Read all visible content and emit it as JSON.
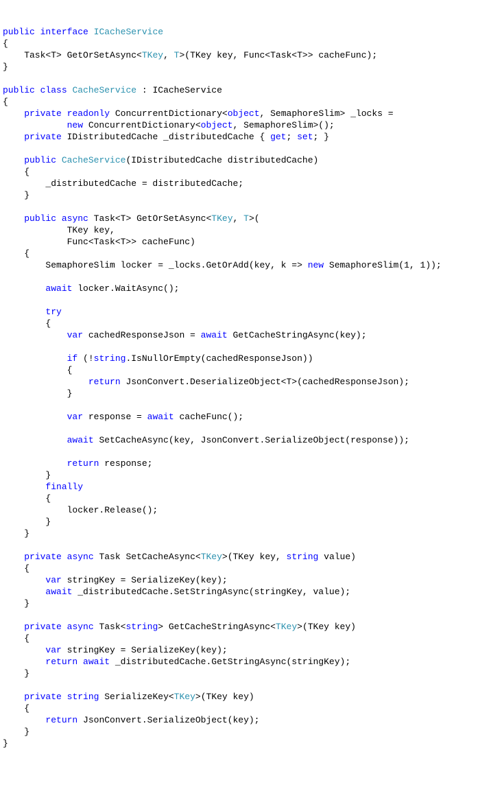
{
  "k": {
    "public": "public",
    "interface": "interface",
    "class": "class",
    "private": "private",
    "readonly": "readonly",
    "new": "new",
    "get": "get",
    "set": "set",
    "async": "async",
    "await": "await",
    "try": "try",
    "finally": "finally",
    "var": "var",
    "if": "if",
    "return": "return",
    "string_kw": "string",
    "object_kw": "object"
  },
  "t": {
    "ICacheService": "ICacheService",
    "CacheService": "CacheService",
    "TKey": "TKey",
    "T": "T"
  },
  "code": {
    "l3": "    Task<T> GetOrSetAsync<",
    "l3b": ">(TKey key, Func<Task<T>> cacheFunc);",
    "l6b": " : ICacheService",
    "l8a": " ConcurrentDictionary<",
    "l8b": ", SemaphoreSlim> _locks =",
    "l9a": " ConcurrentDictionary<",
    "l9b": ", SemaphoreSlim>();",
    "l10a": " IDistributedCache _distributedCache { ",
    "l10b": "; ",
    "l10c": "; }",
    "l12a": "(IDistributedCache distributedCache)",
    "l14": "        _distributedCache = distributedCache;",
    "l17a": " Task<T> GetOrSetAsync<",
    "l17b": ">(",
    "l18": "            TKey key,",
    "l19": "            Func<Task<T>> cacheFunc)",
    "l21a": "        SemaphoreSlim locker = _locks.GetOrAdd(key, k => ",
    "l21b": " SemaphoreSlim(1, 1));",
    "l23a": " locker.WaitAsync();",
    "l27a": " cachedResponseJson = ",
    "l27b": " GetCacheStringAsync(key);",
    "l29a": " (!",
    "l29b": ".IsNullOrEmpty(cachedResponseJson))",
    "l31a": " JsonConvert.DeserializeObject<T>(cachedResponseJson);",
    "l34a": " response = ",
    "l34b": " cacheFunc();",
    "l36a": " SetCacheAsync(key, JsonConvert.SerializeObject(response));",
    "l38a": " response;",
    "l42": "            locker.Release();",
    "l46a": " Task SetCacheAsync<",
    "l46b": ">(TKey key, ",
    "l46c": " value)",
    "l48a": " stringKey = SerializeKey(key);",
    "l49a": " _distributedCache.SetStringAsync(stringKey, value);",
    "l52a": " Task<",
    "l52b": "> GetCacheStringAsync<",
    "l52c": ">(TKey key)",
    "l54a": " stringKey = SerializeKey(key);",
    "l55a": " _distributedCache.GetStringAsync(stringKey);",
    "l58a": " SerializeKey<",
    "l58b": ">(TKey key)",
    "l60a": " JsonConvert.SerializeObject(key);",
    "brace_open": "{",
    "brace_close": "}",
    "ind1_open": "    {",
    "ind1_close": "    }",
    "ind2_open": "        {",
    "ind2_close": "        }",
    "ind3_open": "            {",
    "ind3_close": "            }",
    "comma": ", ",
    "space4": "    ",
    "space8": "        ",
    "space12": "            ",
    "space16": "                "
  }
}
